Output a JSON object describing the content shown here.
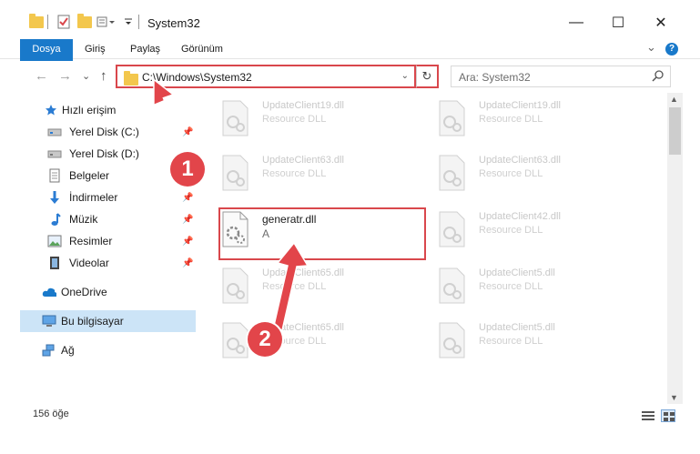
{
  "window": {
    "title": "System32",
    "min_glyph": "—",
    "max_glyph": "☐",
    "close_glyph": "✕"
  },
  "ribbon": {
    "tabs": [
      "Dosya",
      "Giriş",
      "Paylaş",
      "Görünüm"
    ],
    "expand_glyph": "⌄",
    "help_glyph": "?"
  },
  "address": {
    "path": "C:\\Windows\\System32",
    "back_glyph": "←",
    "forward_glyph": "→",
    "recent_glyph": "⌄",
    "up_glyph": "↑",
    "refresh_glyph": "↻",
    "dropdown_glyph": "⌄"
  },
  "search": {
    "placeholder": "Ara: System32"
  },
  "nav": {
    "quick_access": "Hızlı erişim",
    "items": [
      {
        "label": "Yerel Disk (C:)",
        "icon": "drive-icon",
        "pinned": true
      },
      {
        "label": "Yerel Disk (D:)",
        "icon": "drive-icon",
        "pinned": false
      },
      {
        "label": "Belgeler",
        "icon": "documents-icon",
        "pinned": true
      },
      {
        "label": "İndirmeler",
        "icon": "downloads-icon",
        "pinned": true
      },
      {
        "label": "Müzik",
        "icon": "music-icon",
        "pinned": true
      },
      {
        "label": "Resimler",
        "icon": "pictures-icon",
        "pinned": true
      },
      {
        "label": "Videolar",
        "icon": "videos-icon",
        "pinned": true
      }
    ],
    "onedrive": "OneDrive",
    "this_pc": "Bu bilgisayar",
    "network": "Ağ"
  },
  "files": {
    "left": [
      {
        "name": "UpdateClient19.dll",
        "type": "Resource DLL"
      },
      {
        "name": "UpdateClient63.dll",
        "type": "Resource DLL"
      },
      {
        "name": "generatr.dll",
        "type": "A"
      },
      {
        "name": "UpdateClient65.dll",
        "type": "Resource DLL"
      },
      {
        "name": "UpdateClient65.dll",
        "type": "Resource DLL"
      }
    ],
    "right": [
      {
        "name": "UpdateClient19.dll",
        "type": "Resource DLL"
      },
      {
        "name": "UpdateClient63.dll",
        "type": "Resource DLL"
      },
      {
        "name": "UpdateClient42.dll",
        "type": "Resource DLL"
      },
      {
        "name": "UpdateClient5.dll",
        "type": "Resource DLL"
      },
      {
        "name": "UpdateClient5.dll",
        "type": "Resource DLL"
      }
    ]
  },
  "status": {
    "count": "156 öğe"
  },
  "callouts": {
    "one": "1",
    "two": "2"
  },
  "colors": {
    "accent": "#1979ca",
    "highlight": "#d9474c",
    "selection": "#cce4f7",
    "folder": "#f3c74d"
  }
}
